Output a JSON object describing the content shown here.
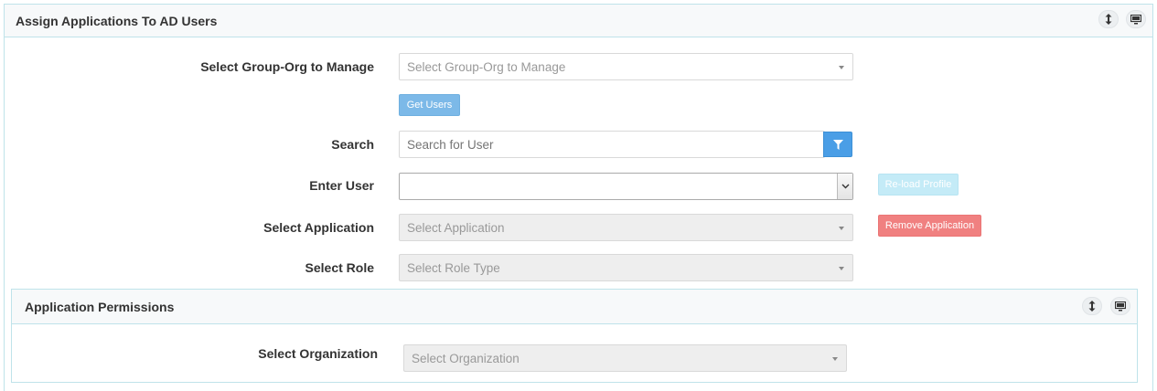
{
  "panel": {
    "title": "Assign Applications To AD Users",
    "icons": [
      "resize-vertical-icon",
      "monitor-icon"
    ]
  },
  "form": {
    "group_org": {
      "label": "Select Group-Org to Manage",
      "placeholder": "Select Group-Org to Manage"
    },
    "get_users_label": "Get Users",
    "search": {
      "label": "Search",
      "placeholder": "Search for User"
    },
    "enter_user": {
      "label": "Enter User",
      "value": ""
    },
    "reload_profile_label": "Re-load Profile",
    "application": {
      "label": "Select Application",
      "placeholder": "Select Application"
    },
    "remove_application_label": "Remove Application",
    "role": {
      "label": "Select Role",
      "placeholder": "Select Role Type"
    }
  },
  "permissions": {
    "title": "Application Permissions",
    "organization": {
      "label": "Select Organization",
      "placeholder": "Select Organization"
    }
  },
  "colors": {
    "accent": "#4a9ee6",
    "button_blue": "#7cb9e8",
    "button_disabled": "#c4ebf7",
    "button_danger": "#f08080",
    "panel_border": "#bfe3ea"
  }
}
